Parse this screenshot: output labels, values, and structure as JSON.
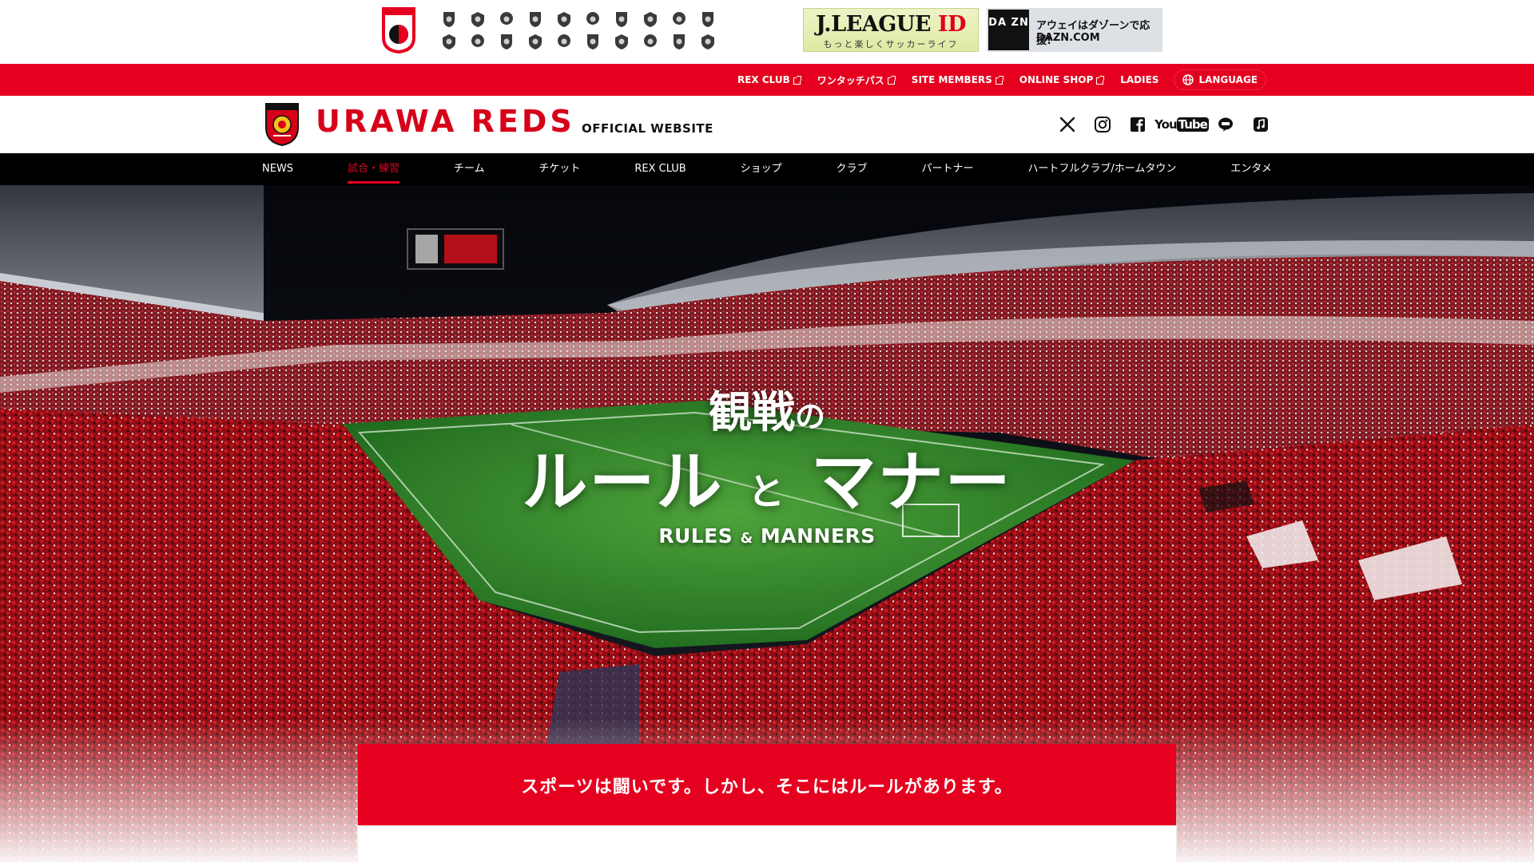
{
  "jleague_strip": {
    "clubs_row1": [
      "club-badge-1",
      "club-badge-2",
      "club-badge-3",
      "club-badge-4",
      "club-badge-5",
      "club-badge-6",
      "club-badge-7",
      "club-badge-8",
      "club-badge-9",
      "club-badge-10"
    ],
    "clubs_row2": [
      "club-badge-11",
      "club-badge-12",
      "club-badge-13",
      "club-badge-14",
      "club-badge-15",
      "club-badge-16",
      "club-badge-17",
      "club-badge-18",
      "club-badge-19",
      "club-badge-20"
    ],
    "jleague_id_banner": {
      "title": "J.LEAGUE",
      "title_accent": "ID",
      "subtitle": "もっと楽しくサッカーライフ"
    },
    "dazn_banner": {
      "logo": "DA ZN",
      "line1": "アウェイはダゾーンで応援!",
      "line2": "DAZN.COM"
    }
  },
  "utility_bar": {
    "links": [
      {
        "label": "REX CLUB",
        "external": true
      },
      {
        "label": "ワンタッチパス",
        "external": true
      },
      {
        "label": "SITE MEMBERS",
        "external": true
      },
      {
        "label": "ONLINE SHOP",
        "external": true
      },
      {
        "label": "LADIES",
        "external": false
      }
    ],
    "language_label": "LANGUAGE",
    "bg_color": "#e6001f"
  },
  "header": {
    "brand": "URAWA REDS",
    "brand_sub": "OFFICIAL WEBSITE",
    "social_icons": [
      "x-icon",
      "instagram-icon",
      "facebook-icon",
      "youtube-icon",
      "line-icon",
      "music-icon"
    ],
    "youtube_label_a": "You",
    "youtube_label_b": "Tube"
  },
  "nav": {
    "items": [
      {
        "label": "NEWS",
        "active": false
      },
      {
        "label": "試合・練習",
        "active": true
      },
      {
        "label": "チーム",
        "active": false
      },
      {
        "label": "チケット",
        "active": false
      },
      {
        "label": "REX CLUB",
        "active": false
      },
      {
        "label": "ショップ",
        "active": false
      },
      {
        "label": "クラブ",
        "active": false
      },
      {
        "label": "パートナー",
        "active": false
      },
      {
        "label": "ハートフルクラブ/ホームタウン",
        "active": false
      },
      {
        "label": "エンタメ",
        "active": false
      }
    ]
  },
  "hero": {
    "title_line1_main": "観戦",
    "title_line1_small": "の",
    "title_line2_a": "ルール",
    "title_line2_small": "と",
    "title_line2_b": "マナー",
    "title_en_a": "RULES",
    "title_en_amp": "&",
    "title_en_b": "MANNERS"
  },
  "statement": {
    "text": "スポーツは闘いです。しかし、そこにはルールがあります。"
  },
  "colors": {
    "brand_red": "#e6001f",
    "nav_bg": "#000000",
    "pitch_green": "#2f8a2a"
  }
}
